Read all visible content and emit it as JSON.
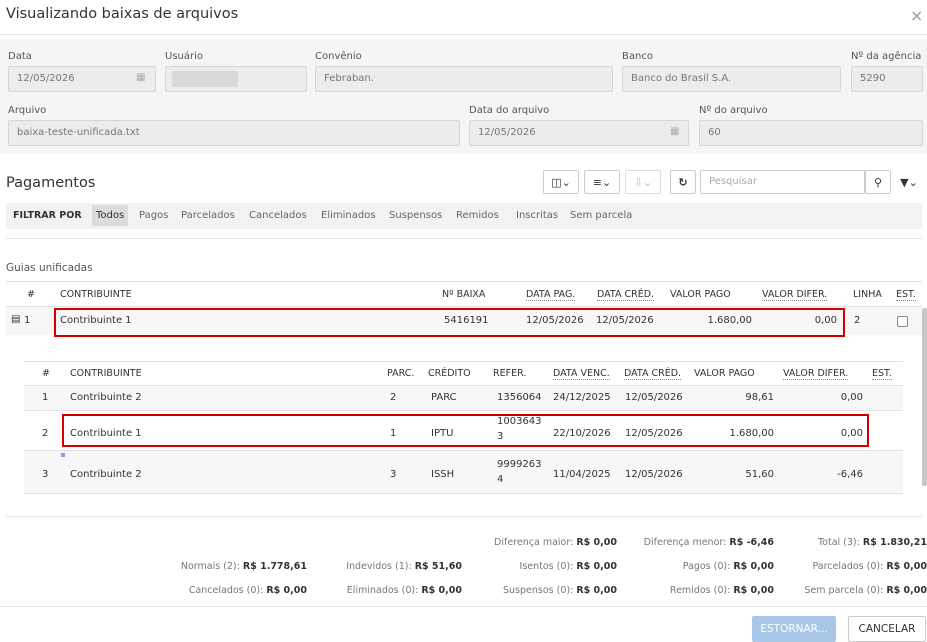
{
  "dialog": {
    "title": "Visualizando baixas de arquivos",
    "close_glyph": "×"
  },
  "form": {
    "data_label": "Data",
    "data_value": "12/05/2026",
    "usuario_label": "Usuário",
    "usuario_value": "",
    "convenio_label": "Convênio",
    "convenio_value": "Febraban.",
    "banco_label": "Banco",
    "banco_value": "Banco do Brasil S.A.",
    "agencia_label": "Nº da agência",
    "agencia_value": "5290",
    "arquivo_label": "Arquivo",
    "arquivo_value": "baixa-teste-unificada.txt",
    "data_arquivo_label": "Data do arquivo",
    "data_arquivo_value": "12/05/2026",
    "num_arquivo_label": "Nº do arquivo",
    "num_arquivo_value": "60"
  },
  "pagamentos": {
    "title": "Pagamentos",
    "search_placeholder": "Pesquisar",
    "filter_label": "FILTRAR POR",
    "filters": [
      "Todos",
      "Pagos",
      "Parcelados",
      "Cancelados",
      "Eliminados",
      "Suspensos",
      "Remidos",
      "Inscritas",
      "Sem parcela"
    ],
    "active_filter": "Todos"
  },
  "guias": {
    "title": "Guias unificadas",
    "headers": [
      "#",
      "CONTRIBUINTE",
      "Nº BAIXA",
      "DATA PAG.",
      "DATA CRÉD.",
      "VALOR PAGO",
      "VALOR DIFER.",
      "LINHA",
      "EST."
    ],
    "row": {
      "num": "1",
      "contribuinte": "Contribuinte 1",
      "baixa": "5416191",
      "data_pag": "12/05/2026",
      "data_cred": "12/05/2026",
      "valor_pago": "1.680,00",
      "valor_difer": "0,00",
      "linha": "2",
      "est_checked": false
    }
  },
  "detail": {
    "headers": [
      "#",
      "CONTRIBUINTE",
      "PARC.",
      "CRÉDITO",
      "REFER.",
      "DATA VENC.",
      "DATA CRÉD.",
      "VALOR PAGO",
      "VALOR DIFER.",
      "EST."
    ],
    "rows": [
      {
        "num": "1",
        "contribuinte": "Contribuinte 2",
        "parc": "2",
        "credito": "PARC",
        "refer1": "1356064",
        "refer2": "",
        "venc": "24/12/2025",
        "cred": "12/05/2026",
        "pago": "98,61",
        "difer": "0,00"
      },
      {
        "num": "2",
        "contribuinte": "Contribuinte 1",
        "parc": "1",
        "credito": "IPTU",
        "refer1": "1003643",
        "refer2": "3",
        "venc": "22/10/2026",
        "cred": "12/05/2026",
        "pago": "1.680,00",
        "difer": "0,00"
      },
      {
        "num": "3",
        "contribuinte": "Contribuinte 2",
        "parc": "3",
        "credito": "ISSH",
        "refer1": "9999263",
        "refer2": "4",
        "venc": "11/04/2025",
        "cred": "12/05/2026",
        "pago": "51,60",
        "difer": "-6,46"
      }
    ]
  },
  "summary": {
    "dif_maior_label": "Diferença maior:",
    "dif_maior_value": "R$ 0,00",
    "dif_menor_label": "Diferença menor:",
    "dif_menor_value": "R$ -6,46",
    "total_label": "Total (3):",
    "total_value": "R$ 1.830,21",
    "normais_label": "Normais (2):",
    "normais_value": "R$ 1.778,61",
    "indevidos_label": "Indevidos (1):",
    "indevidos_value": "R$ 51,60",
    "isentos_label": "Isentos (0):",
    "isentos_value": "R$ 0,00",
    "pagos_label": "Pagos (0):",
    "pagos_value": "R$ 0,00",
    "parcelados_label": "Parcelados (0):",
    "parcelados_value": "R$ 0,00",
    "cancelados_label": "Cancelados (0):",
    "cancelados_value": "R$ 0,00",
    "eliminados_label": "Eliminados (0):",
    "eliminados_value": "R$ 0,00",
    "suspensos_label": "Suspensos (0):",
    "suspensos_value": "R$ 0,00",
    "remidos_label": "Remidos (0):",
    "remidos_value": "R$ 0,00",
    "semparcela_label": "Sem parcela (0):",
    "semparcela_value": "R$ 0,00"
  },
  "actions": {
    "estornar": "ESTORNAR...",
    "cancelar": "CANCELAR"
  },
  "colors": {
    "highlight": "#d00000",
    "primary_disabled": "#a8c7e6"
  }
}
